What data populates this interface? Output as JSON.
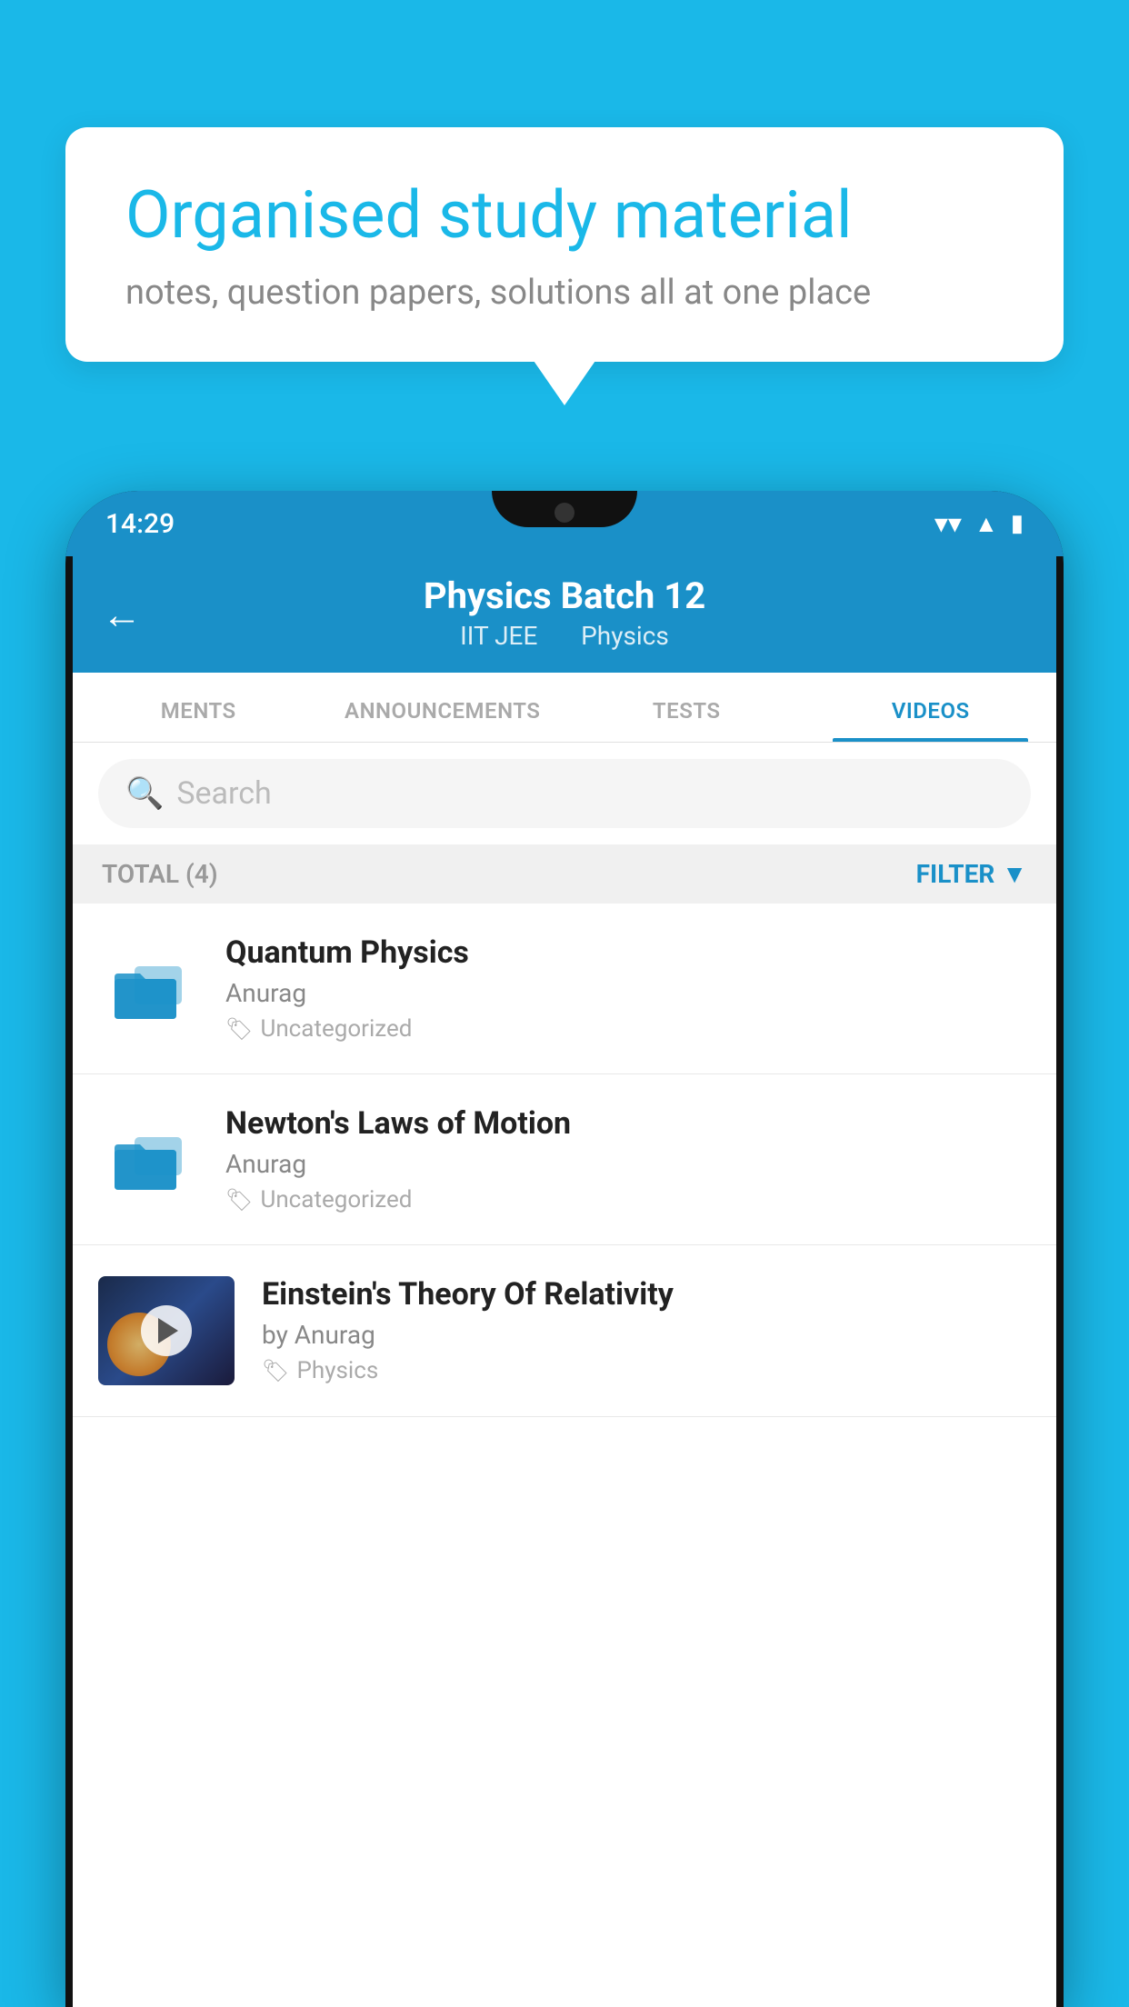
{
  "background_color": "#1ab8e8",
  "bubble": {
    "title": "Organised study material",
    "subtitle": "notes, question papers, solutions all at one place"
  },
  "phone": {
    "status_bar": {
      "time": "14:29",
      "wifi_icon": "wifi",
      "signal_icon": "signal",
      "battery_icon": "battery"
    },
    "header": {
      "back_label": "←",
      "title": "Physics Batch 12",
      "subtitle_part1": "IIT JEE",
      "subtitle_part2": "Physics"
    },
    "tabs": [
      {
        "label": "MENTS",
        "active": false
      },
      {
        "label": "ANNOUNCEMENTS",
        "active": false
      },
      {
        "label": "TESTS",
        "active": false
      },
      {
        "label": "VIDEOS",
        "active": true
      }
    ],
    "search": {
      "placeholder": "Search"
    },
    "filter_bar": {
      "total_label": "TOTAL (4)",
      "filter_label": "FILTER"
    },
    "videos": [
      {
        "id": 1,
        "title": "Quantum Physics",
        "author": "Anurag",
        "tag": "Uncategorized",
        "type": "folder",
        "thumbnail": null
      },
      {
        "id": 2,
        "title": "Newton's Laws of Motion",
        "author": "Anurag",
        "tag": "Uncategorized",
        "type": "folder",
        "thumbnail": null
      },
      {
        "id": 3,
        "title": "Einstein's Theory Of Relativity",
        "author": "by Anurag",
        "tag": "Physics",
        "type": "video",
        "thumbnail": "space"
      }
    ]
  }
}
